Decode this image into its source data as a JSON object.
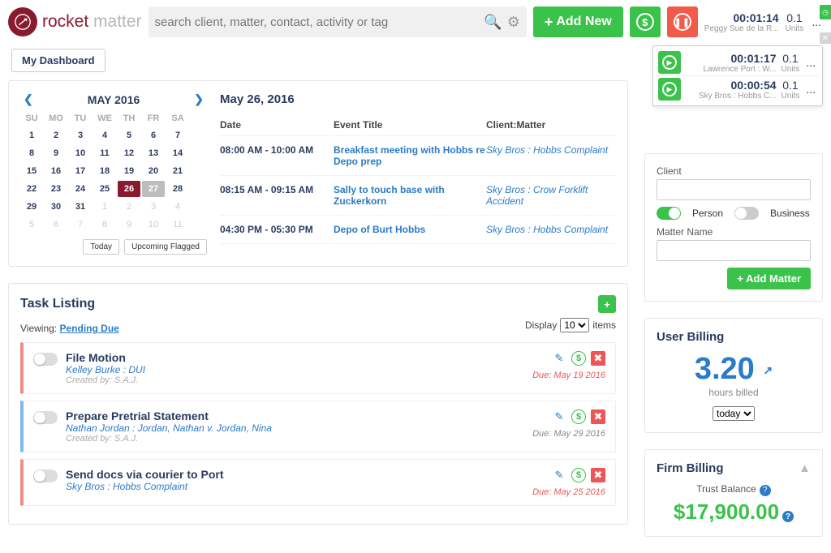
{
  "logo": {
    "bold": "rocket",
    "thin": " matter"
  },
  "search": {
    "placeholder": "search client, matter, contact, activity or tag"
  },
  "addnew": "Add New",
  "maintimer": {
    "time": "00:01:14",
    "sub": "Peggy Sue de la R...",
    "units": "0.1",
    "unitslab": "Units",
    "ell": "..."
  },
  "timers": [
    {
      "time": "00:01:17",
      "sub": "Lawrence Port : W...",
      "units": "0.1",
      "unitslab": "Units",
      "ell": "..."
    },
    {
      "time": "00:00:54",
      "sub": "Sky Bros : Hobbs C...",
      "units": "0.1",
      "unitslab": "Units",
      "ell": "..."
    }
  ],
  "dashtab": "My Dashboard",
  "cal": {
    "title": "MAY 2016",
    "dow": [
      "SU",
      "MO",
      "TU",
      "WE",
      "TH",
      "FR",
      "SA"
    ],
    "footer": {
      "today": "Today",
      "flag": "Upcoming Flagged"
    }
  },
  "events": {
    "date": "May 26, 2016",
    "cols": {
      "date": "Date",
      "title": "Event Title",
      "cm": "Client:Matter"
    },
    "rows": [
      {
        "time": "08:00 AM - 10:00 AM",
        "title": "Breakfast meeting with Hobbs re Depo prep",
        "cm": "Sky Bros : Hobbs Complaint"
      },
      {
        "time": "08:15 AM - 09:15 AM",
        "title": "Sally to touch base with Zuckerkorn",
        "cm": "Sky Bros : Crow Forklift Accident"
      },
      {
        "time": "04:30 PM - 05:30 PM",
        "title": "Depo of Burt Hobbs",
        "cm": "Sky Bros : Hobbs Complaint"
      }
    ]
  },
  "tasks": {
    "title": "Task Listing",
    "viewing_pre": "Viewing: ",
    "viewing_link": "Pending Due",
    "display_pre": "Display",
    "display_post": "items",
    "options": [
      "10"
    ],
    "items": [
      {
        "title": "File Motion",
        "cm": "Kelley Burke : DUI",
        "by": "Created by: S.A.J.",
        "due": "Due: May 19 2016",
        "late": true
      },
      {
        "title": "Prepare Pretrial Statement",
        "cm": "Nathan Jordan : Jordan, Nathan v. Jordan, Nina",
        "by": "Created by: S.A.J.",
        "due": "Due: May 29 2016",
        "late": false
      },
      {
        "title": "Send docs via courier to Port",
        "cm": "Sky Bros : Hobbs Complaint",
        "by": "",
        "due": "Due: May 25 2016",
        "late": true
      }
    ]
  },
  "addmatter": {
    "client": "Client",
    "person": "Person",
    "business": "Business",
    "mname": "Matter Name",
    "btn": "Add Matter"
  },
  "userbill": {
    "title": "User Billing",
    "num": "3.20",
    "sub": "hours billed",
    "sel": "today"
  },
  "firmbill": {
    "title": "Firm Billing",
    "lab": "Trust Balance",
    "amt": "$17,900.00"
  }
}
